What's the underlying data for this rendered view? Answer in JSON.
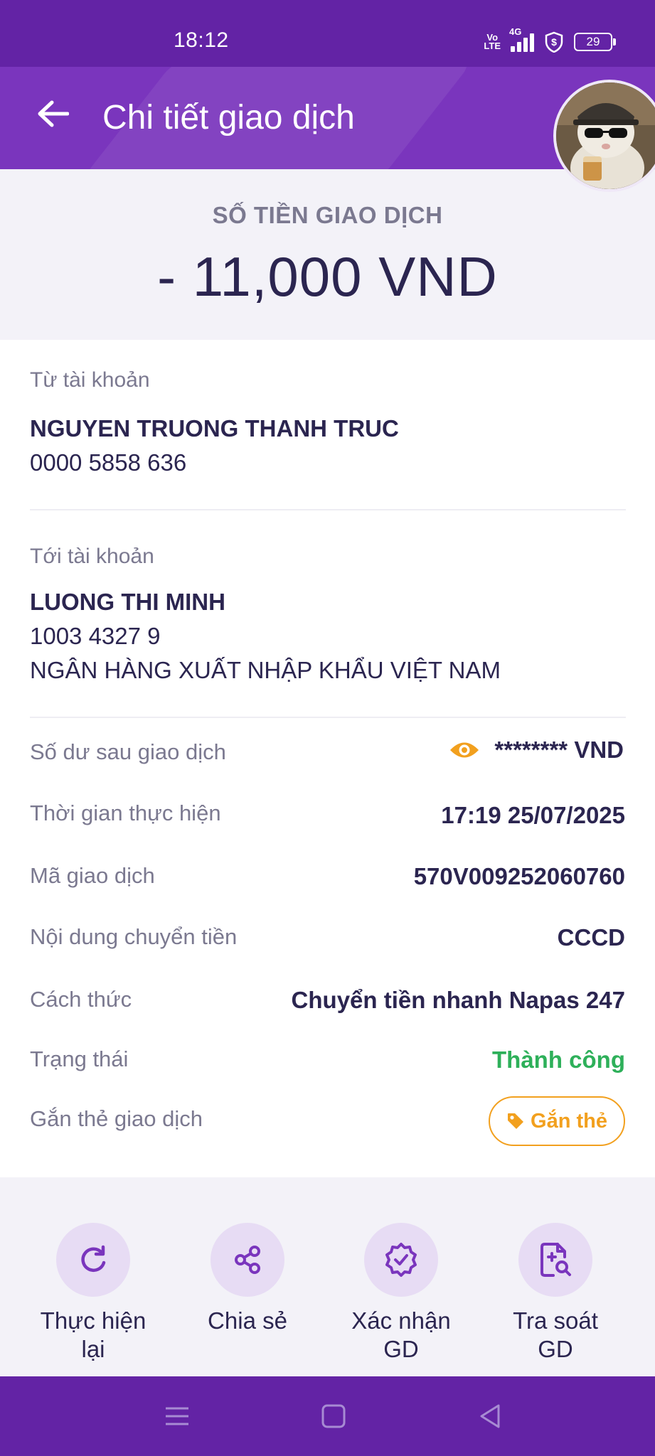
{
  "status_bar": {
    "time": "18:12",
    "volte_top": "Vo",
    "volte_bottom": "LTE",
    "network": "4G",
    "battery": "29"
  },
  "header": {
    "title": "Chi tiết giao dịch",
    "back_icon": "arrow-left-icon"
  },
  "amount": {
    "label": "SỐ TIỀN GIAO DỊCH",
    "value": "- 11,000 VND"
  },
  "from_account": {
    "label": "Từ tài khoản",
    "name": "NGUYEN TRUONG THANH TRUC",
    "number": "0000 5858 636"
  },
  "to_account": {
    "label": "Tới tài khoản",
    "name": "LUONG THI MINH",
    "number": "1003 4327 9",
    "bank": "NGÂN HÀNG XUẤT NHẬP KHẨU VIỆT NAM"
  },
  "details": {
    "balance_label": "Số dư sau giao dịch",
    "balance_value": "******** VND",
    "time_label": "Thời gian thực hiện",
    "time_value": "17:19 25/07/2025",
    "code_label": "Mã giao dịch",
    "code_value": "570V009252060760",
    "content_label": "Nội dung chuyển tiền",
    "content_value": "CCCD",
    "method_label": "Cách thức",
    "method_value": "Chuyển tiền nhanh Napas 247",
    "status_label": "Trạng thái",
    "status_value": "Thành công",
    "tag_label": "Gắn thẻ giao dịch",
    "tag_button": "Gắn thẻ"
  },
  "actions": [
    {
      "line1": "Thực hiện",
      "line2": "lại",
      "icon": "repeat-icon"
    },
    {
      "line1": "Chia sẻ",
      "line2": "",
      "icon": "share-icon"
    },
    {
      "line1": "Xác nhận",
      "line2": "GD",
      "icon": "verified-badge-icon"
    },
    {
      "line1": "Tra soát",
      "line2": "GD",
      "icon": "document-search-icon"
    }
  ],
  "colors": {
    "primary_purple": "#6323a5",
    "header_purple": "#7a35bd",
    "success_green": "#2eb05a",
    "tag_orange": "#f2a01e",
    "text_dark": "#2b2550",
    "text_muted": "#7b7990"
  }
}
